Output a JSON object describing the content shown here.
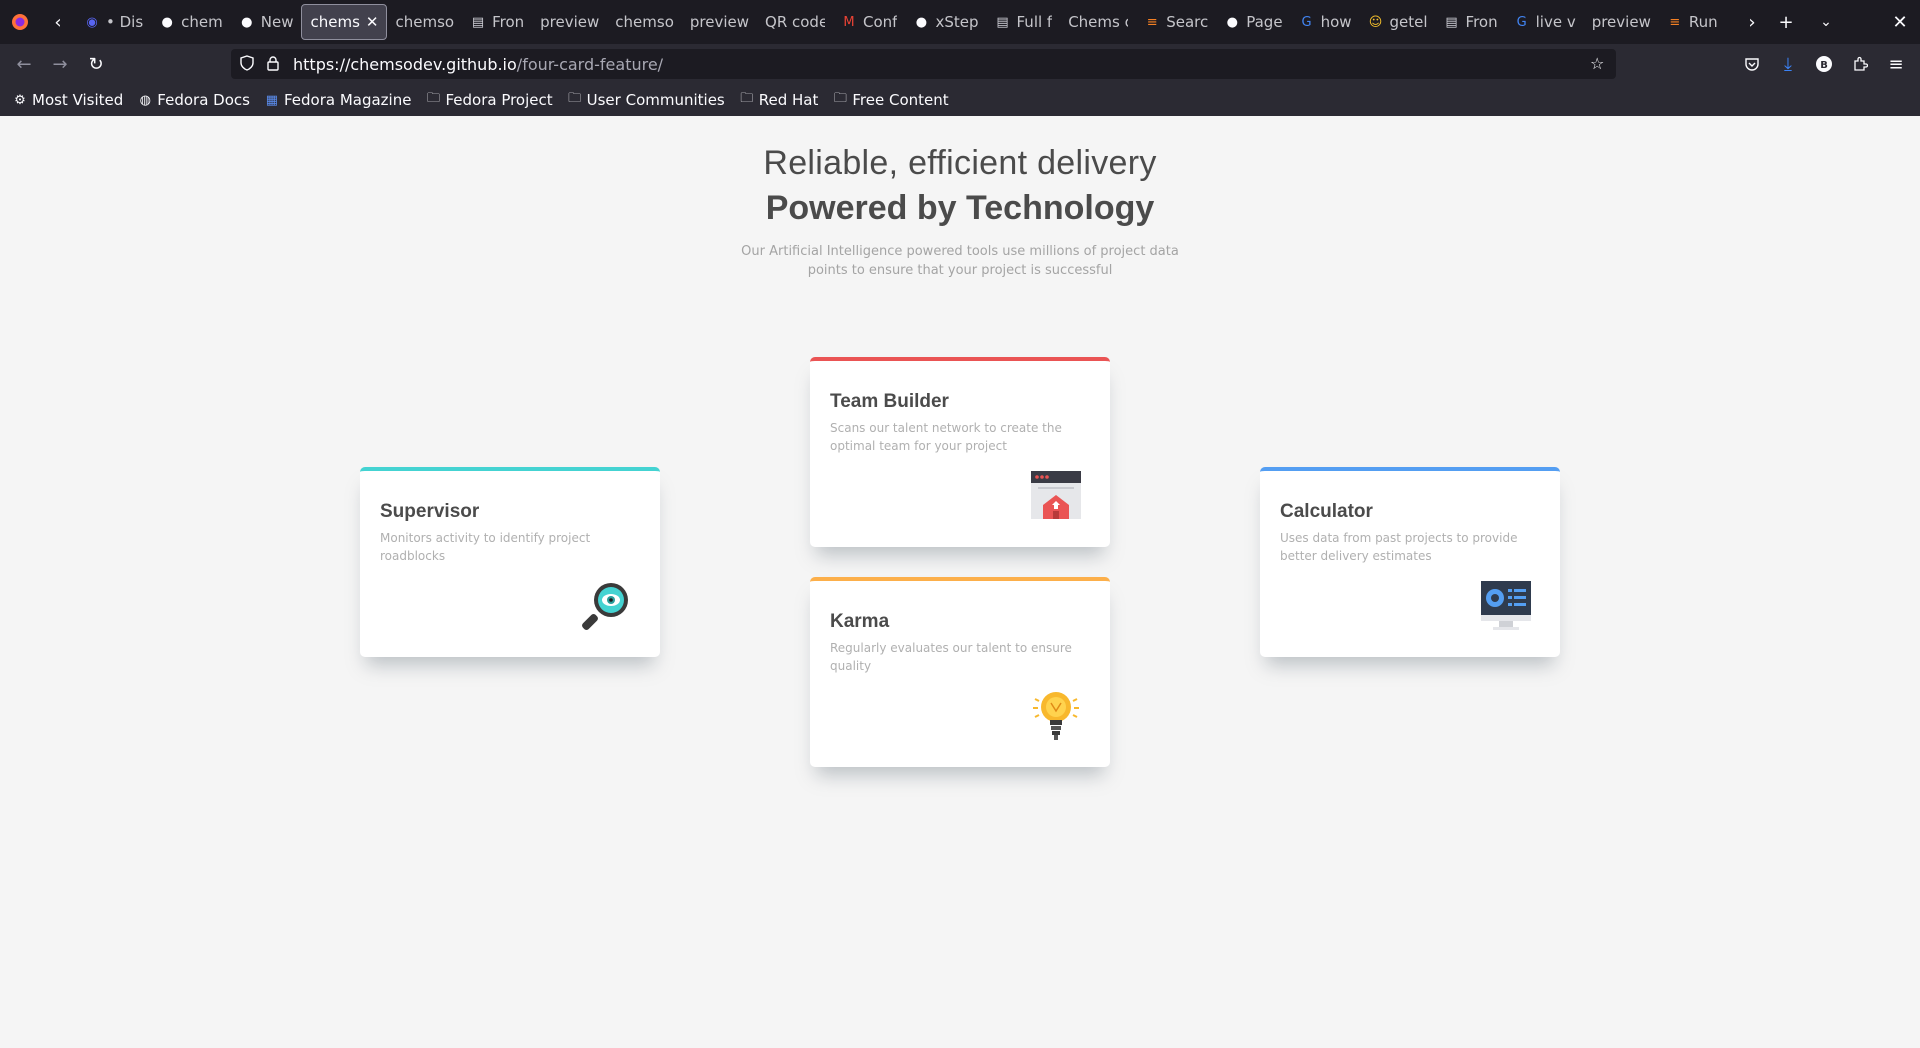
{
  "browser": {
    "tabs": [
      {
        "label": "• Dis",
        "icon": "discord-icon"
      },
      {
        "label": "chem",
        "icon": "github-icon"
      },
      {
        "label": "New",
        "icon": "github-icon"
      },
      {
        "label": "chems",
        "icon": "",
        "active": true
      },
      {
        "label": "chemso",
        "icon": ""
      },
      {
        "label": "Fron",
        "icon": "page-icon"
      },
      {
        "label": "preview",
        "icon": ""
      },
      {
        "label": "chemso",
        "icon": ""
      },
      {
        "label": "preview",
        "icon": ""
      },
      {
        "label": "QR code",
        "icon": ""
      },
      {
        "label": "Conf",
        "icon": "gmail-icon"
      },
      {
        "label": "xStep",
        "icon": "github-icon"
      },
      {
        "label": "Full f",
        "icon": "page-icon"
      },
      {
        "label": "Chems c",
        "icon": ""
      },
      {
        "label": "Searc",
        "icon": "stackoverflow-icon"
      },
      {
        "label": "Page",
        "icon": "github-icon"
      },
      {
        "label": "how",
        "icon": "google-icon"
      },
      {
        "label": "getel",
        "icon": "emoji-icon"
      },
      {
        "label": "Fron",
        "icon": "page-icon"
      },
      {
        "label": "live v",
        "icon": "google-icon"
      },
      {
        "label": "preview",
        "icon": ""
      },
      {
        "label": "Run",
        "icon": "stackoverflow-icon"
      }
    ],
    "url_host": "https://chemsodev.github.io",
    "url_path": "/four-card-feature/",
    "bookmarks": [
      {
        "label": "Most Visited",
        "icon": "gear-icon"
      },
      {
        "label": "Fedora Docs",
        "icon": "globe-icon"
      },
      {
        "label": "Fedora Magazine",
        "icon": "fm-icon"
      },
      {
        "label": "Fedora Project",
        "icon": "folder-icon"
      },
      {
        "label": "User Communities",
        "icon": "folder-icon"
      },
      {
        "label": "Red Hat",
        "icon": "folder-icon"
      },
      {
        "label": "Free Content",
        "icon": "folder-icon"
      }
    ]
  },
  "hero": {
    "title_light": "Reliable, efficient delivery",
    "title_bold": "Powered by Technology",
    "description": "Our Artificial Intelligence powered tools use millions of project data points to ensure that your project is successful"
  },
  "cards": {
    "supervisor": {
      "title": "Supervisor",
      "description": "Monitors activity to identify project roadblocks",
      "accent": "#44d3d2",
      "icon": "magnifier-icon"
    },
    "team_builder": {
      "title": "Team Builder",
      "description": "Scans our talent network to create the optimal team for your project",
      "accent": "#ea5454",
      "icon": "team-builder-icon"
    },
    "karma": {
      "title": "Karma",
      "description": "Regularly evaluates our talent to ensure quality",
      "accent": "#fcaf4a",
      "icon": "lightbulb-icon"
    },
    "calculator": {
      "title": "Calculator",
      "description": "Uses data from past projects to provide better delivery estimates",
      "accent": "#549ef2",
      "icon": "monitor-icon"
    }
  }
}
